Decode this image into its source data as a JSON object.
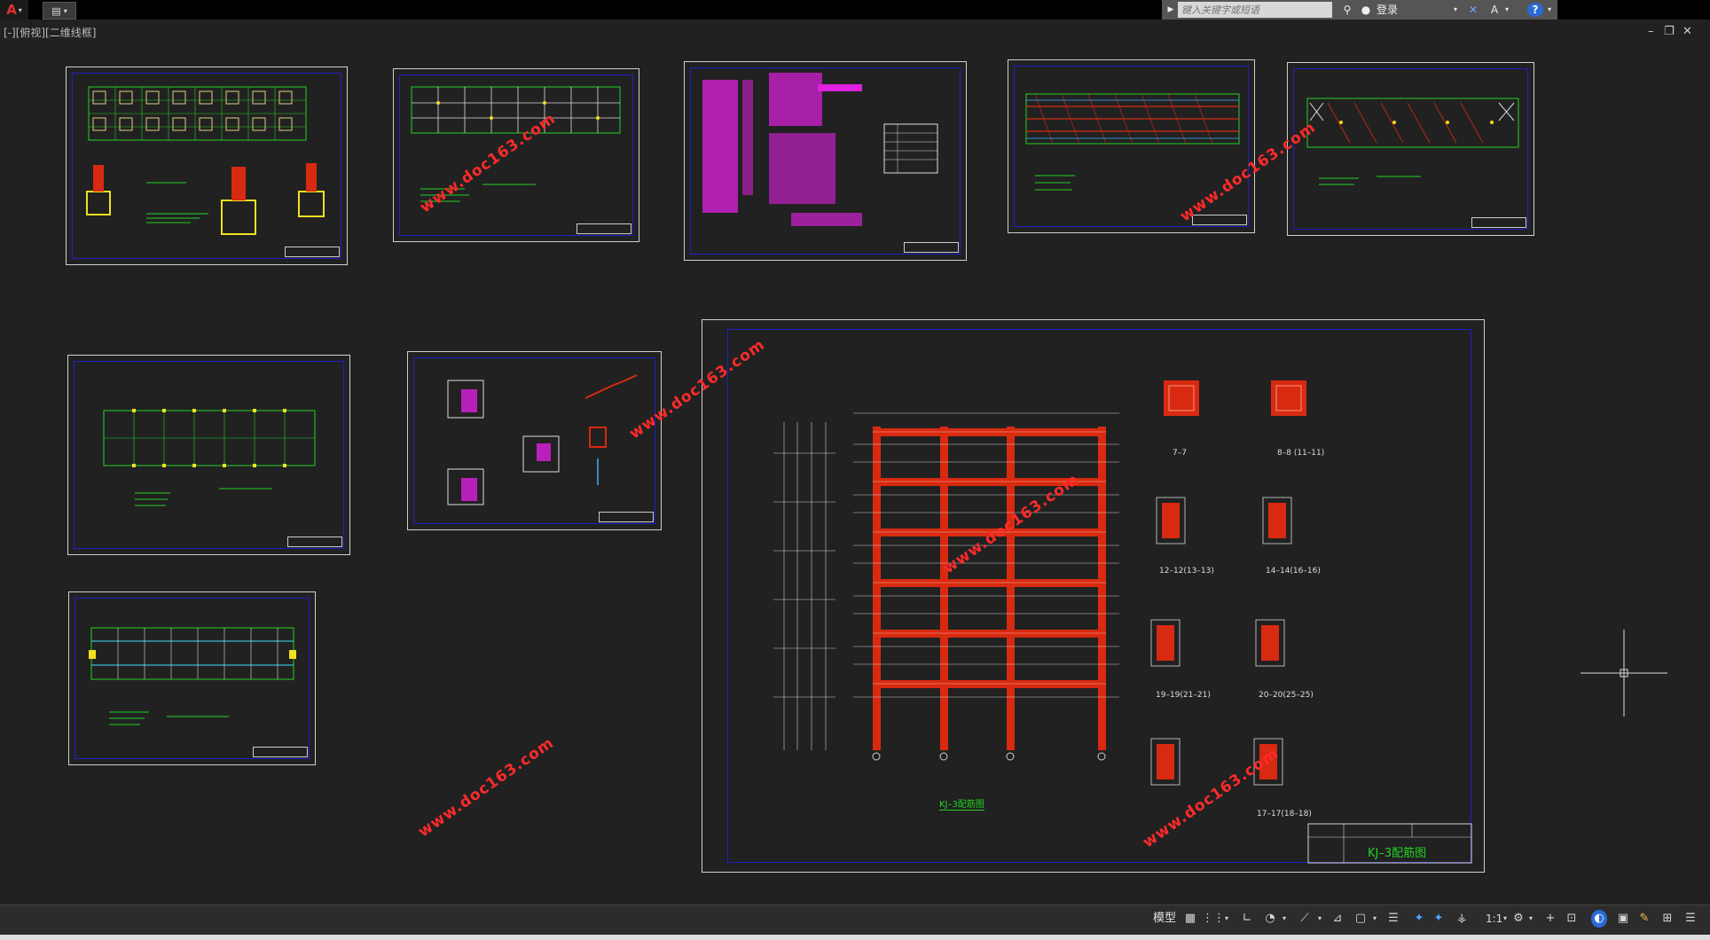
{
  "toolbar": {
    "search_placeholder": "键入关键字或短语",
    "login_label": "登录"
  },
  "viewport": {
    "label": "[-][俯视][二维线框]"
  },
  "window_controls": {
    "minimize": "–",
    "restore": "❐",
    "close": "✕"
  },
  "drawing": {
    "frame_title": "KJ–3配筋图",
    "section_labels": [
      "7–7",
      "8–8 (11–11)",
      "12–12(13–13)",
      "14–14(16–16)",
      "19–19(21–21)",
      "20–20(25–25)",
      "17–17(18–18)"
    ],
    "watermark": "www.doc163.com"
  },
  "statusbar": {
    "model_label": "模型",
    "scale_label": "1:1"
  },
  "colors": {
    "background": "#212121",
    "axis_green": "#23d123",
    "frame_red": "#d82a10",
    "magenta_text": "#e020e0",
    "border_blue": "#2020c8",
    "watermark_red": "#ff2a2a"
  }
}
